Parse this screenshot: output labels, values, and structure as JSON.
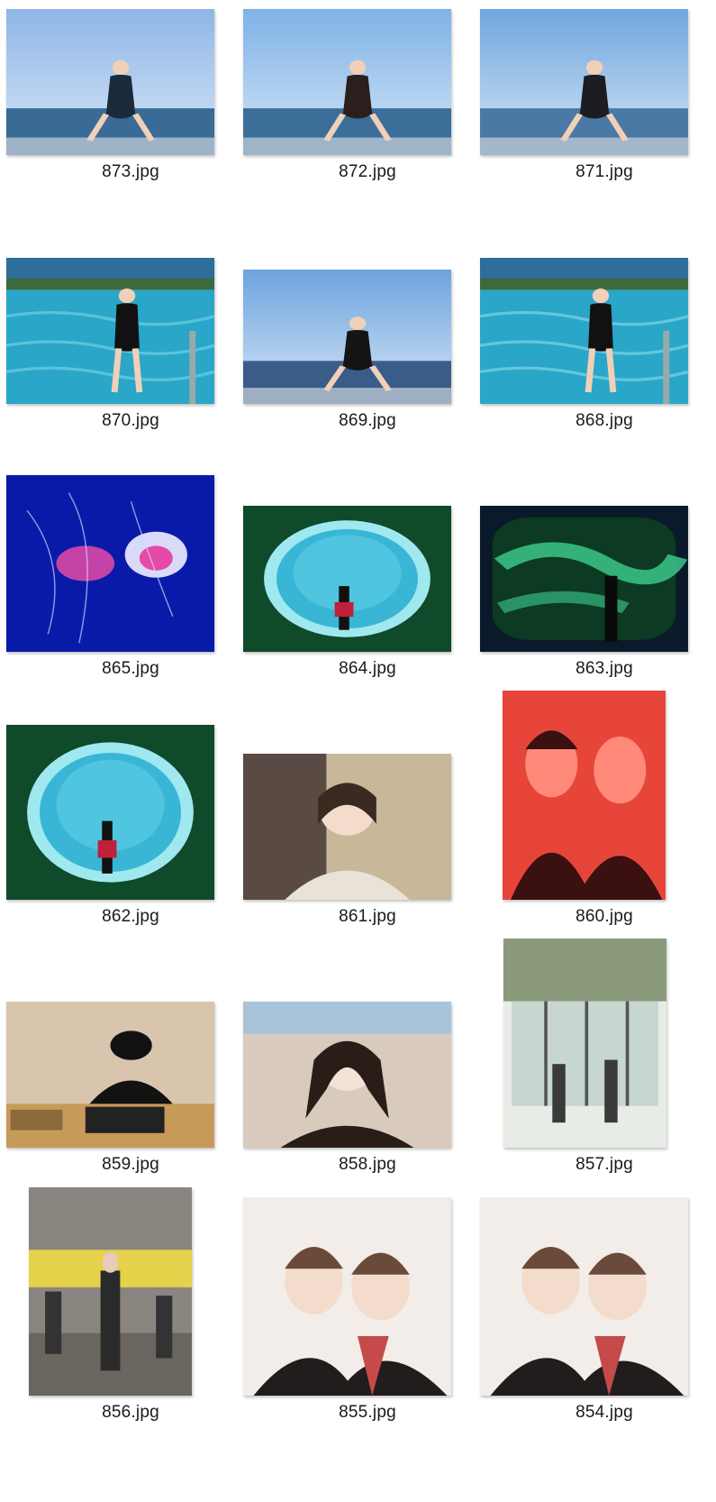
{
  "files": [
    {
      "name": "873.jpg",
      "scene": "beach-swimsuit-sitting",
      "orientation": "landscape",
      "palette": [
        "#8fb6e6",
        "#3a6a96",
        "#1b2a3a"
      ]
    },
    {
      "name": "872.jpg",
      "scene": "pool-edge-lying",
      "orientation": "landscape",
      "palette": [
        "#7eb2e6",
        "#3b6f9a",
        "#2a1f1c"
      ]
    },
    {
      "name": "871.jpg",
      "scene": "pool-edge-sitting",
      "orientation": "landscape",
      "palette": [
        "#6fa6de",
        "#4a79a6",
        "#1c1c22"
      ]
    },
    {
      "name": "870.jpg",
      "scene": "pool-ladder",
      "orientation": "landscape",
      "palette": [
        "#2aa6c8",
        "#6cd0e4",
        "#1f3a2a"
      ]
    },
    {
      "name": "869.jpg",
      "scene": "sea-back-view",
      "orientation": "landscape",
      "palette": [
        "#6da3de",
        "#395c88",
        "#141414"
      ]
    },
    {
      "name": "868.jpg",
      "scene": "pool-ladder-standing",
      "orientation": "landscape",
      "palette": [
        "#2aa6c8",
        "#7fd4e6",
        "#1f3a2a"
      ]
    },
    {
      "name": "865.jpg",
      "scene": "jellyfish",
      "orientation": "landscape",
      "palette": [
        "#0a1aa8",
        "#e64aa6",
        "#f0f0ff"
      ]
    },
    {
      "name": "864.jpg",
      "scene": "aquarium-round-window",
      "orientation": "landscape",
      "palette": [
        "#0f4a2a",
        "#39b6d6",
        "#9fe8f0"
      ]
    },
    {
      "name": "863.jpg",
      "scene": "aquarium-green-tank",
      "orientation": "landscape",
      "palette": [
        "#0c3a22",
        "#3fcf8f",
        "#0a1a2a"
      ]
    },
    {
      "name": "862.jpg",
      "scene": "aquarium-round-window-standing",
      "orientation": "landscape",
      "palette": [
        "#0f4a2a",
        "#39b6d6",
        "#9fe8f0"
      ]
    },
    {
      "name": "861.jpg",
      "scene": "portrait-curtains",
      "orientation": "landscape",
      "palette": [
        "#5a4a44",
        "#e8e2d8",
        "#c9b79a"
      ]
    },
    {
      "name": "860.jpg",
      "scene": "two-friends-red",
      "orientation": "portrait",
      "palette": [
        "#e8453a",
        "#ff8a7a",
        "#3a1010"
      ]
    },
    {
      "name": "859.jpg",
      "scene": "barbecue-table",
      "orientation": "landscape",
      "palette": [
        "#d9c4ae",
        "#121212",
        "#c79a5a"
      ]
    },
    {
      "name": "858.jpg",
      "scene": "portrait-sofa",
      "orientation": "landscape",
      "palette": [
        "#d8cbbd",
        "#2a1d18",
        "#f3e3d6"
      ]
    },
    {
      "name": "857.jpg",
      "scene": "gym-window",
      "orientation": "portrait",
      "palette": [
        "#c7d6cf",
        "#3a3a3a",
        "#e8ece6"
      ]
    },
    {
      "name": "856.jpg",
      "scene": "gym-standing",
      "orientation": "portrait",
      "palette": [
        "#8a857e",
        "#e5d24a",
        "#2a2a2a"
      ]
    },
    {
      "name": "855.jpg",
      "scene": "two-women-uniform",
      "orientation": "landscape-tall",
      "palette": [
        "#f2ede8",
        "#221c1c",
        "#c54a4a"
      ]
    },
    {
      "name": "854.jpg",
      "scene": "two-women-uniform-2",
      "orientation": "landscape-tall",
      "palette": [
        "#f2ede8",
        "#221c1c",
        "#c54a4a"
      ]
    }
  ]
}
